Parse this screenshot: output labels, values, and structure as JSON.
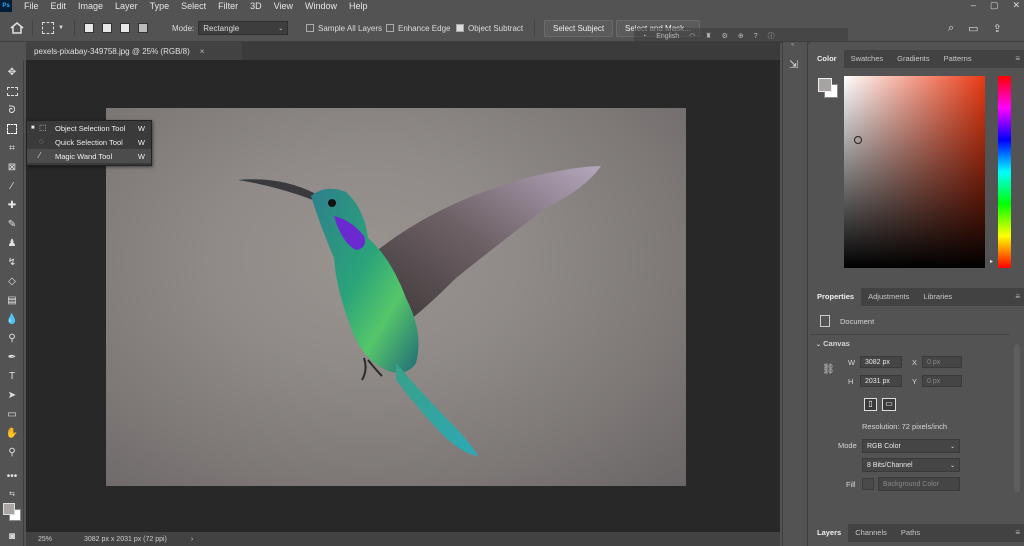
{
  "menubar": {
    "logo": "Ps",
    "items": [
      "File",
      "Edit",
      "Image",
      "Layer",
      "Type",
      "Select",
      "Filter",
      "3D",
      "View",
      "Window",
      "Help"
    ],
    "window_controls": [
      "–",
      "▢",
      "✕"
    ]
  },
  "options": {
    "mode_label": "Mode:",
    "mode_value": "Rectangle",
    "sample_all_layers": "Sample All Layers",
    "enhance_edge": "Enhance Edge",
    "object_subtract": "Object Subtract",
    "select_subject": "Select Subject",
    "select_and_mask": "Select and Mask...",
    "overlay_language": "English"
  },
  "document": {
    "tab_title": "pexels-pixabay-349758.jpg @ 25% (RGB/8)",
    "close": "×"
  },
  "flyout": [
    {
      "label": "Object Selection Tool",
      "key": "W",
      "bullet": "■"
    },
    {
      "label": "Quick Selection Tool",
      "key": "W",
      "bullet": ""
    },
    {
      "label": "Magic Wand Tool",
      "key": "W",
      "bullet": ""
    }
  ],
  "status": {
    "zoom": "25%",
    "doc_info": "3082 px x 2031 px (72 ppi)",
    "arrow": "›"
  },
  "color_panel": {
    "tabs": [
      "Color",
      "Swatches",
      "Gradients",
      "Patterns"
    ],
    "active_tab": "Color"
  },
  "properties_panel": {
    "tabs": [
      "Properties",
      "Adjustments",
      "Libraries"
    ],
    "document_label": "Document",
    "canvas_label": "Canvas",
    "w_label": "W",
    "w_value": "3082 px",
    "h_label": "H",
    "h_value": "2031 px",
    "x_label": "X",
    "x_value": "0 px",
    "y_label": "Y",
    "y_value": "0 px",
    "resolution": "Resolution: 72 pixels/inch",
    "mode_label": "Mode",
    "mode_value": "RGB Color",
    "bits_value": "8 Bits/Channel",
    "fill_label": "Fill",
    "fill_value": "Background Color"
  },
  "layers_panel": {
    "tabs": [
      "Layers",
      "Channels",
      "Paths"
    ]
  },
  "colors": {
    "foreground": "#a8a4a4",
    "background": "#ffffff"
  }
}
